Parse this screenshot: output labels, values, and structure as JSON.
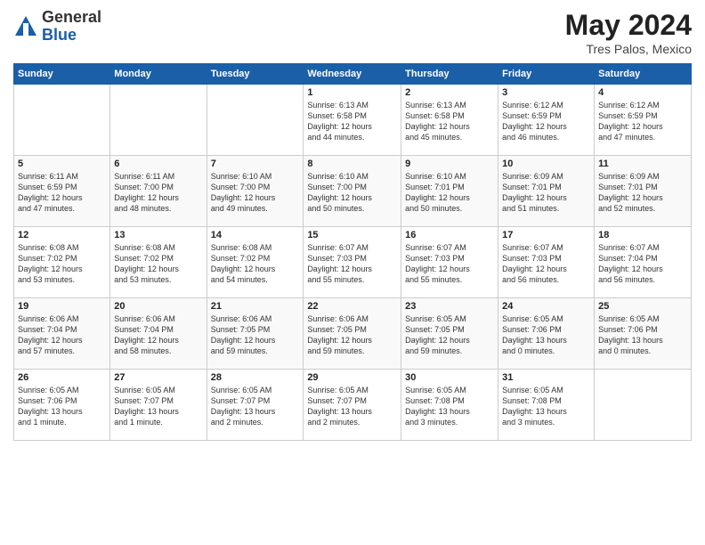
{
  "header": {
    "logo_general": "General",
    "logo_blue": "Blue",
    "month_year": "May 2024",
    "location": "Tres Palos, Mexico"
  },
  "days_of_week": [
    "Sunday",
    "Monday",
    "Tuesday",
    "Wednesday",
    "Thursday",
    "Friday",
    "Saturday"
  ],
  "weeks": [
    {
      "days": [
        {
          "num": "",
          "info": ""
        },
        {
          "num": "",
          "info": ""
        },
        {
          "num": "",
          "info": ""
        },
        {
          "num": "1",
          "info": "Sunrise: 6:13 AM\nSunset: 6:58 PM\nDaylight: 12 hours\nand 44 minutes."
        },
        {
          "num": "2",
          "info": "Sunrise: 6:13 AM\nSunset: 6:58 PM\nDaylight: 12 hours\nand 45 minutes."
        },
        {
          "num": "3",
          "info": "Sunrise: 6:12 AM\nSunset: 6:59 PM\nDaylight: 12 hours\nand 46 minutes."
        },
        {
          "num": "4",
          "info": "Sunrise: 6:12 AM\nSunset: 6:59 PM\nDaylight: 12 hours\nand 47 minutes."
        }
      ]
    },
    {
      "days": [
        {
          "num": "5",
          "info": "Sunrise: 6:11 AM\nSunset: 6:59 PM\nDaylight: 12 hours\nand 47 minutes."
        },
        {
          "num": "6",
          "info": "Sunrise: 6:11 AM\nSunset: 7:00 PM\nDaylight: 12 hours\nand 48 minutes."
        },
        {
          "num": "7",
          "info": "Sunrise: 6:10 AM\nSunset: 7:00 PM\nDaylight: 12 hours\nand 49 minutes."
        },
        {
          "num": "8",
          "info": "Sunrise: 6:10 AM\nSunset: 7:00 PM\nDaylight: 12 hours\nand 50 minutes."
        },
        {
          "num": "9",
          "info": "Sunrise: 6:10 AM\nSunset: 7:01 PM\nDaylight: 12 hours\nand 50 minutes."
        },
        {
          "num": "10",
          "info": "Sunrise: 6:09 AM\nSunset: 7:01 PM\nDaylight: 12 hours\nand 51 minutes."
        },
        {
          "num": "11",
          "info": "Sunrise: 6:09 AM\nSunset: 7:01 PM\nDaylight: 12 hours\nand 52 minutes."
        }
      ]
    },
    {
      "days": [
        {
          "num": "12",
          "info": "Sunrise: 6:08 AM\nSunset: 7:02 PM\nDaylight: 12 hours\nand 53 minutes."
        },
        {
          "num": "13",
          "info": "Sunrise: 6:08 AM\nSunset: 7:02 PM\nDaylight: 12 hours\nand 53 minutes."
        },
        {
          "num": "14",
          "info": "Sunrise: 6:08 AM\nSunset: 7:02 PM\nDaylight: 12 hours\nand 54 minutes."
        },
        {
          "num": "15",
          "info": "Sunrise: 6:07 AM\nSunset: 7:03 PM\nDaylight: 12 hours\nand 55 minutes."
        },
        {
          "num": "16",
          "info": "Sunrise: 6:07 AM\nSunset: 7:03 PM\nDaylight: 12 hours\nand 55 minutes."
        },
        {
          "num": "17",
          "info": "Sunrise: 6:07 AM\nSunset: 7:03 PM\nDaylight: 12 hours\nand 56 minutes."
        },
        {
          "num": "18",
          "info": "Sunrise: 6:07 AM\nSunset: 7:04 PM\nDaylight: 12 hours\nand 56 minutes."
        }
      ]
    },
    {
      "days": [
        {
          "num": "19",
          "info": "Sunrise: 6:06 AM\nSunset: 7:04 PM\nDaylight: 12 hours\nand 57 minutes."
        },
        {
          "num": "20",
          "info": "Sunrise: 6:06 AM\nSunset: 7:04 PM\nDaylight: 12 hours\nand 58 minutes."
        },
        {
          "num": "21",
          "info": "Sunrise: 6:06 AM\nSunset: 7:05 PM\nDaylight: 12 hours\nand 59 minutes."
        },
        {
          "num": "22",
          "info": "Sunrise: 6:06 AM\nSunset: 7:05 PM\nDaylight: 12 hours\nand 59 minutes."
        },
        {
          "num": "23",
          "info": "Sunrise: 6:05 AM\nSunset: 7:05 PM\nDaylight: 12 hours\nand 59 minutes."
        },
        {
          "num": "24",
          "info": "Sunrise: 6:05 AM\nSunset: 7:06 PM\nDaylight: 13 hours\nand 0 minutes."
        },
        {
          "num": "25",
          "info": "Sunrise: 6:05 AM\nSunset: 7:06 PM\nDaylight: 13 hours\nand 0 minutes."
        }
      ]
    },
    {
      "days": [
        {
          "num": "26",
          "info": "Sunrise: 6:05 AM\nSunset: 7:06 PM\nDaylight: 13 hours\nand 1 minute."
        },
        {
          "num": "27",
          "info": "Sunrise: 6:05 AM\nSunset: 7:07 PM\nDaylight: 13 hours\nand 1 minute."
        },
        {
          "num": "28",
          "info": "Sunrise: 6:05 AM\nSunset: 7:07 PM\nDaylight: 13 hours\nand 2 minutes."
        },
        {
          "num": "29",
          "info": "Sunrise: 6:05 AM\nSunset: 7:07 PM\nDaylight: 13 hours\nand 2 minutes."
        },
        {
          "num": "30",
          "info": "Sunrise: 6:05 AM\nSunset: 7:08 PM\nDaylight: 13 hours\nand 3 minutes."
        },
        {
          "num": "31",
          "info": "Sunrise: 6:05 AM\nSunset: 7:08 PM\nDaylight: 13 hours\nand 3 minutes."
        },
        {
          "num": "",
          "info": ""
        }
      ]
    }
  ]
}
